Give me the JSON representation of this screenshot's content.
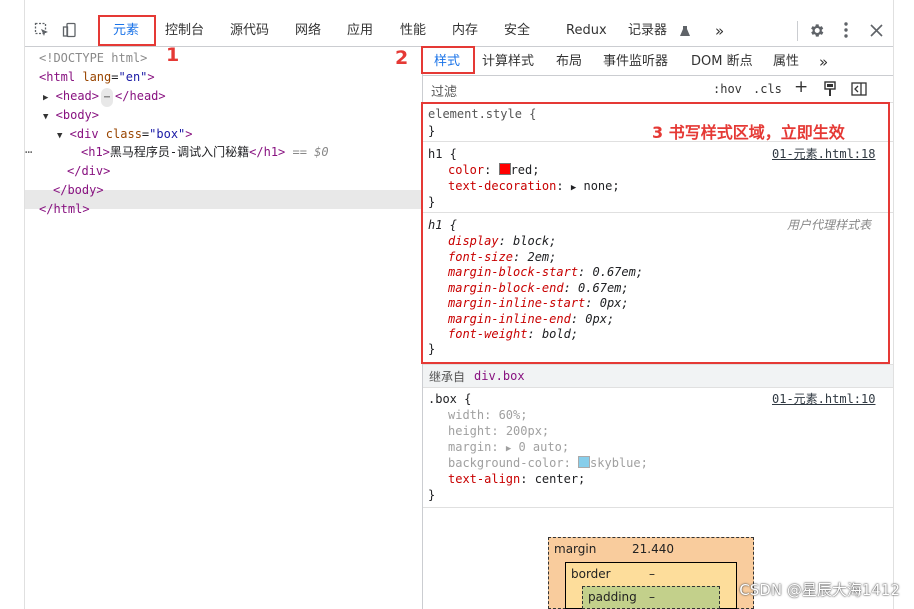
{
  "toolbar": {
    "tabs": [
      "元素",
      "控制台",
      "源代码",
      "网络",
      "应用",
      "性能",
      "内存",
      "安全",
      "Redux",
      "记录器",
      "»"
    ]
  },
  "elements": {
    "doctype": "<!DOCTYPE html>",
    "html_open_tag": "<html",
    "html_lang_attr": "lang",
    "html_lang_val": "\"en\"",
    "html_close_bracket": ">",
    "head_open": "<head>",
    "head_ellipsis": "⋯",
    "head_close": "</head>",
    "body_open": "<body>",
    "div_open_tag": "<div",
    "div_class_attr": "class",
    "div_class_val": "\"box\"",
    "div_close_bracket": ">",
    "row_dots": "⋯",
    "h1_open": "<h1>",
    "h1_text": "黑马程序员-调试入门秘籍",
    "h1_close": "</h1>",
    "h1_marker": " == $0",
    "div_close": "</div>",
    "body_close": "</body>",
    "html_close": "</html>"
  },
  "styles": {
    "subtabs": [
      "样式",
      "计算样式",
      "布局",
      "事件监听器",
      "DOM 断点",
      "属性",
      "»"
    ],
    "filter_placeholder": "过滤",
    "hov": ":hov",
    "cls": ".cls",
    "add": "+",
    "element_style_open": "element.style {",
    "brace_close": "}",
    "rule1": {
      "selector": "h1 {",
      "source": "01-元素.html:18",
      "color_prop": "color",
      "color_val": "red;",
      "color_swatch": "#ff0000",
      "td_prop": "text-decoration",
      "td_val": "none;"
    },
    "rule2": {
      "selector": "h1 {",
      "source": "用户代理样式表",
      "props": [
        {
          "name": "display",
          "value": "block;"
        },
        {
          "name": "font-size",
          "value": "2em;"
        },
        {
          "name": "margin-block-start",
          "value": "0.67em;"
        },
        {
          "name": "margin-block-end",
          "value": "0.67em;"
        },
        {
          "name": "margin-inline-start",
          "value": "0px;"
        },
        {
          "name": "margin-inline-end",
          "value": "0px;"
        },
        {
          "name": "font-weight",
          "value": "bold;"
        }
      ]
    },
    "inherited_label": "继承自",
    "inherited_selector": "div.box",
    "rule3": {
      "selector": ".box {",
      "source": "01-元素.html:10",
      "width": {
        "name": "width",
        "value": "60%;"
      },
      "height": {
        "name": "height",
        "value": "200px;"
      },
      "margin": {
        "name": "margin",
        "value": "0 auto;"
      },
      "bg": {
        "name": "background-color",
        "value": "skyblue;",
        "swatch": "#87ceeb"
      },
      "align": {
        "name": "text-align",
        "value": "center;"
      }
    }
  },
  "box_model": {
    "margin_label": "margin",
    "margin_value": "21.440",
    "border_label": "border",
    "border_value": "–",
    "padding_label": "padding",
    "padding_value": "–"
  },
  "annotations": {
    "label1": "1",
    "label2": "2",
    "label3": "3 书写样式区域，立即生效",
    "accent": "#e53935"
  },
  "watermark": "CSDN @星辰大海1412"
}
